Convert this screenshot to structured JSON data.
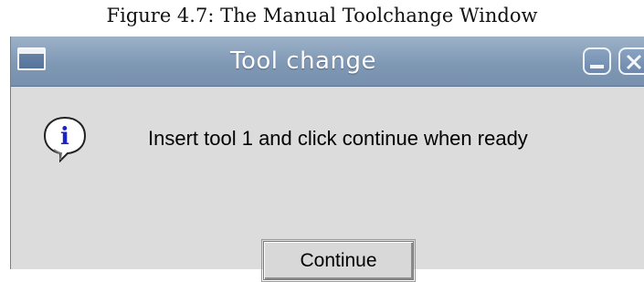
{
  "figure": {
    "caption": "Figure 4.7: The Manual Toolchange Window"
  },
  "window": {
    "title": "Tool change",
    "controls": {
      "menu_icon": "window-menu-icon",
      "minimize_icon": "minimize-icon",
      "close_icon": "close-icon"
    }
  },
  "dialog": {
    "icon": "info-icon",
    "message": "Insert tool 1 and click continue when ready",
    "button_label": "Continue"
  },
  "colors": {
    "titlebar": "#8199b5",
    "dialog_background": "#dcdcdc",
    "info_blue": "#1a24c8"
  }
}
